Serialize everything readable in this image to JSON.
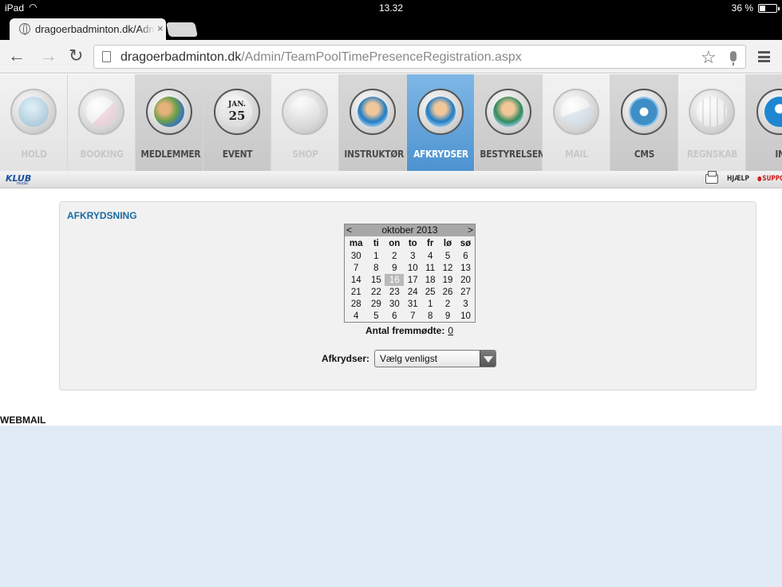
{
  "status_bar": {
    "device": "iPad",
    "time": "13.32",
    "battery": "36 %",
    "battery_level": 0.36
  },
  "browser": {
    "tab_title": "dragoerbadminton.dk/Admin",
    "tab_close": "×",
    "url_host": "dragoerbadminton.dk",
    "url_path": "/Admin/TeamPoolTimePresenceRegistration.aspx"
  },
  "modules": [
    {
      "label": "HOLD",
      "icon": "coach-icon",
      "state": "faded"
    },
    {
      "label": "BOOKING",
      "icon": "notepad-icon",
      "state": "faded"
    },
    {
      "label": "MEDLEMMER",
      "icon": "members-icon",
      "state": "dark"
    },
    {
      "label": "EVENT",
      "icon": "calendar-icon",
      "state": "dark",
      "icon_text_top": "JAN.",
      "icon_text_bottom": "25"
    },
    {
      "label": "SHOP",
      "icon": "shopping-bag-icon",
      "state": "faded"
    },
    {
      "label": "INSTRUKTØR",
      "icon": "instructor-icon",
      "state": "dark"
    },
    {
      "label": "AFKRYDSER",
      "icon": "checker-icon",
      "state": "active"
    },
    {
      "label": "BESTYRELSEN",
      "icon": "board-icon",
      "state": "dark"
    },
    {
      "label": "MAIL",
      "icon": "envelope-icon",
      "state": "faded"
    },
    {
      "label": "CMS",
      "icon": "gear-icon",
      "state": "dark"
    },
    {
      "label": "REGNSKAB",
      "icon": "calculator-icon",
      "state": "faded"
    },
    {
      "label": "IN",
      "icon": "info-icon",
      "state": "dark"
    }
  ],
  "subbar": {
    "logo": "KLUB",
    "logo_sub": "modul",
    "help": "HJÆLP",
    "support": "SUPPORT"
  },
  "panel": {
    "title": "AFKRYDSNING",
    "calendar": {
      "month": "oktober 2013",
      "prev": "<",
      "next": ">",
      "weekdays": [
        "ma",
        "ti",
        "on",
        "to",
        "fr",
        "lø",
        "sø"
      ],
      "weeks": [
        [
          "30",
          "1",
          "2",
          "3",
          "4",
          "5",
          "6"
        ],
        [
          "7",
          "8",
          "9",
          "10",
          "11",
          "12",
          "13"
        ],
        [
          "14",
          "15",
          "16",
          "17",
          "18",
          "19",
          "20"
        ],
        [
          "21",
          "22",
          "23",
          "24",
          "25",
          "26",
          "27"
        ],
        [
          "28",
          "29",
          "30",
          "31",
          "1",
          "2",
          "3"
        ],
        [
          "4",
          "5",
          "6",
          "7",
          "8",
          "9",
          "10"
        ]
      ],
      "selected": "16"
    },
    "count_label": "Antal fremmødte:",
    "count_value": "0",
    "select_label": "Afkrydser:",
    "select_value": "Vælg venligst"
  },
  "webmail_label": "WEBMAIL",
  "colors": {
    "accent": "#1a6aa3",
    "active_tab": "#5a9fd8",
    "webmail_bg": "#e0ebf5"
  }
}
